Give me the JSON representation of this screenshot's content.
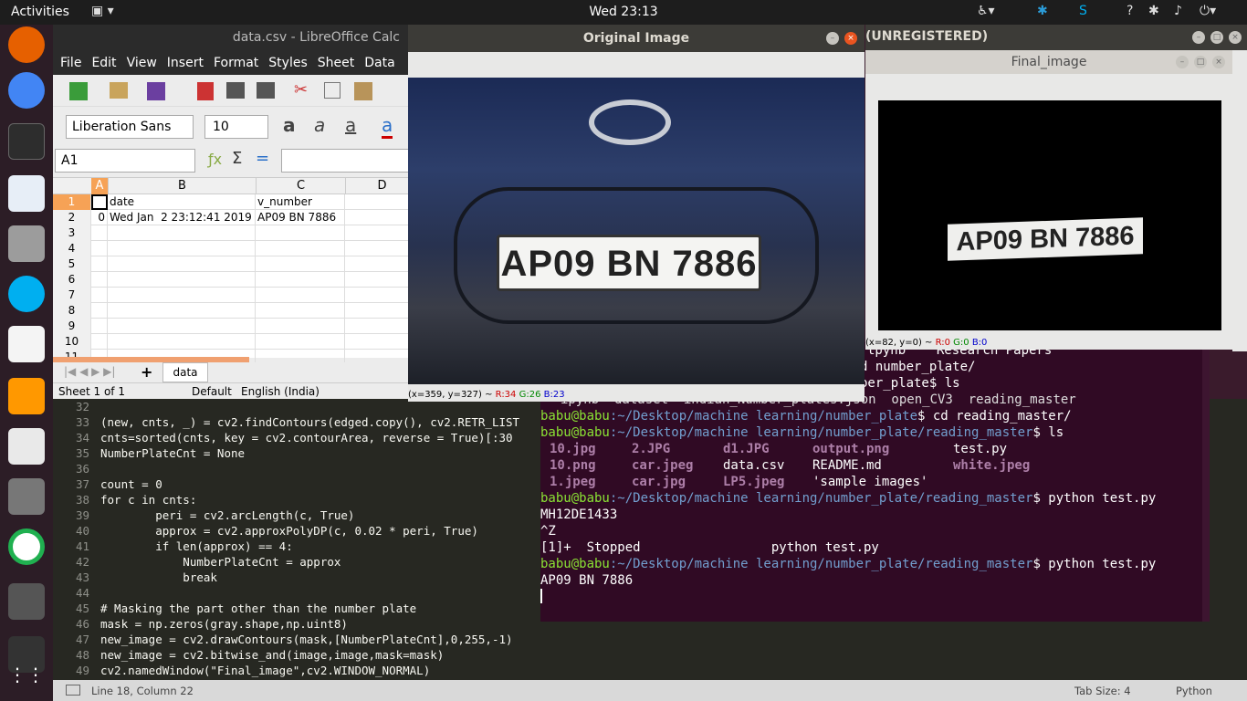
{
  "topbar": {
    "activities": "Activities",
    "clock": "Wed 23:13"
  },
  "sublime": {
    "lines": [
      {
        "n": "32",
        "t": ""
      },
      {
        "n": "33",
        "t": "(new, cnts, _) = cv2.findContours(edged.copy(), cv2.RETR_LIST"
      },
      {
        "n": "34",
        "t": "cnts=sorted(cnts, key = cv2.contourArea, reverse = True)[:30"
      },
      {
        "n": "35",
        "t": "NumberPlateCnt = None"
      },
      {
        "n": "36",
        "t": ""
      },
      {
        "n": "37",
        "t": "count = 0"
      },
      {
        "n": "38",
        "t": "for c in cnts:"
      },
      {
        "n": "39",
        "t": "        peri = cv2.arcLength(c, True)"
      },
      {
        "n": "40",
        "t": "        approx = cv2.approxPolyDP(c, 0.02 * peri, True)"
      },
      {
        "n": "41",
        "t": "        if len(approx) == 4:"
      },
      {
        "n": "42",
        "t": "            NumberPlateCnt = approx"
      },
      {
        "n": "43",
        "t": "            break"
      },
      {
        "n": "44",
        "t": ""
      },
      {
        "n": "45",
        "t": "# Masking the part other than the number plate"
      },
      {
        "n": "46",
        "t": "mask = np.zeros(gray.shape,np.uint8)"
      },
      {
        "n": "47",
        "t": "new_image = cv2.drawContours(mask,[NumberPlateCnt],0,255,-1)"
      },
      {
        "n": "48",
        "t": "new_image = cv2.bitwise_and(image,image,mask=mask)"
      },
      {
        "n": "49",
        "t": "cv2.namedWindow(\"Final_image\",cv2.WINDOW_NORMAL)"
      }
    ],
    "status_left": "Line 18, Column 22",
    "tab_size": "Tab Size: 4",
    "syntax": "Python"
  },
  "terminal": {
    "partial": [
      "tpynb    Research Papers'",
      "d number_plate/",
      "ber_plate$ ls",
      "ipynb  dataset  indian_Number_plates.json  open_CV3  reading_master"
    ],
    "prompt": "babu@babu",
    "path1": ":~/Desktop/machine learning/number_plate",
    "cmd1": "$ cd reading_master/",
    "path2": ":~/Desktop/machine learning/number_plate/reading_master",
    "cmd2": "$ ls",
    "files": [
      [
        "10.jpg",
        "2.JPG",
        "d1.JPG",
        "output.png",
        "test.py"
      ],
      [
        "10.png",
        "car.jpeg",
        "data.csv",
        "README.md",
        "white.jpeg"
      ],
      [
        "1.jpeg",
        "car.jpg",
        "LP5.jpeg",
        "'sample images'",
        ""
      ]
    ],
    "cmd3": "$ python test.py",
    "out1": "MH12DE1433",
    "out2": "^Z",
    "out3": "[1]+  Stopped                 python test.py",
    "cmd4": "$ python test.py",
    "out4": "AP09 BN 7886"
  },
  "calc": {
    "title": "data.csv - LibreOffice Calc",
    "menu": [
      "File",
      "Edit",
      "View",
      "Insert",
      "Format",
      "Styles",
      "Sheet",
      "Data"
    ],
    "font": "Liberation Sans",
    "size": "10",
    "cellref": "A1",
    "cols": [
      "A",
      "B",
      "C",
      "D"
    ],
    "rows": [
      [
        "1",
        "",
        "date",
        "v_number",
        ""
      ],
      [
        "2",
        "0",
        "Wed Jan  2 23:12:41 2019",
        "AP09 BN 7886",
        ""
      ],
      [
        "3",
        "",
        "",
        "",
        ""
      ],
      [
        "4",
        "",
        "",
        "",
        ""
      ],
      [
        "5",
        "",
        "",
        "",
        ""
      ],
      [
        "6",
        "",
        "",
        "",
        ""
      ],
      [
        "7",
        "",
        "",
        "",
        ""
      ],
      [
        "8",
        "",
        "",
        "",
        ""
      ],
      [
        "9",
        "",
        "",
        "",
        ""
      ],
      [
        "10",
        "",
        "",
        "",
        ""
      ],
      [
        "11",
        "",
        "",
        "",
        ""
      ]
    ],
    "sheet_tab": "data",
    "status": [
      "Sheet 1 of 1",
      "Default",
      "English (India)"
    ]
  },
  "orig": {
    "title": "Original Image",
    "plate": "AP09 BN 7886",
    "coords": "(x=359, y=327) ~ ",
    "r": "R:34",
    "g": "G:26",
    "b": "B:23"
  },
  "final": {
    "title": "Final_image",
    "plate": "AP09 BN 7886",
    "coords": "(x=82, y=0) ~ ",
    "r": "R:0",
    "g": "G:0",
    "b": "B:0",
    "unreg": "(UNREGISTERED)"
  },
  "colors": {
    "terminal_bg": "#300a24",
    "prompt": "#8ae234",
    "path": "#729fcf",
    "sublime_bg": "#272822"
  }
}
